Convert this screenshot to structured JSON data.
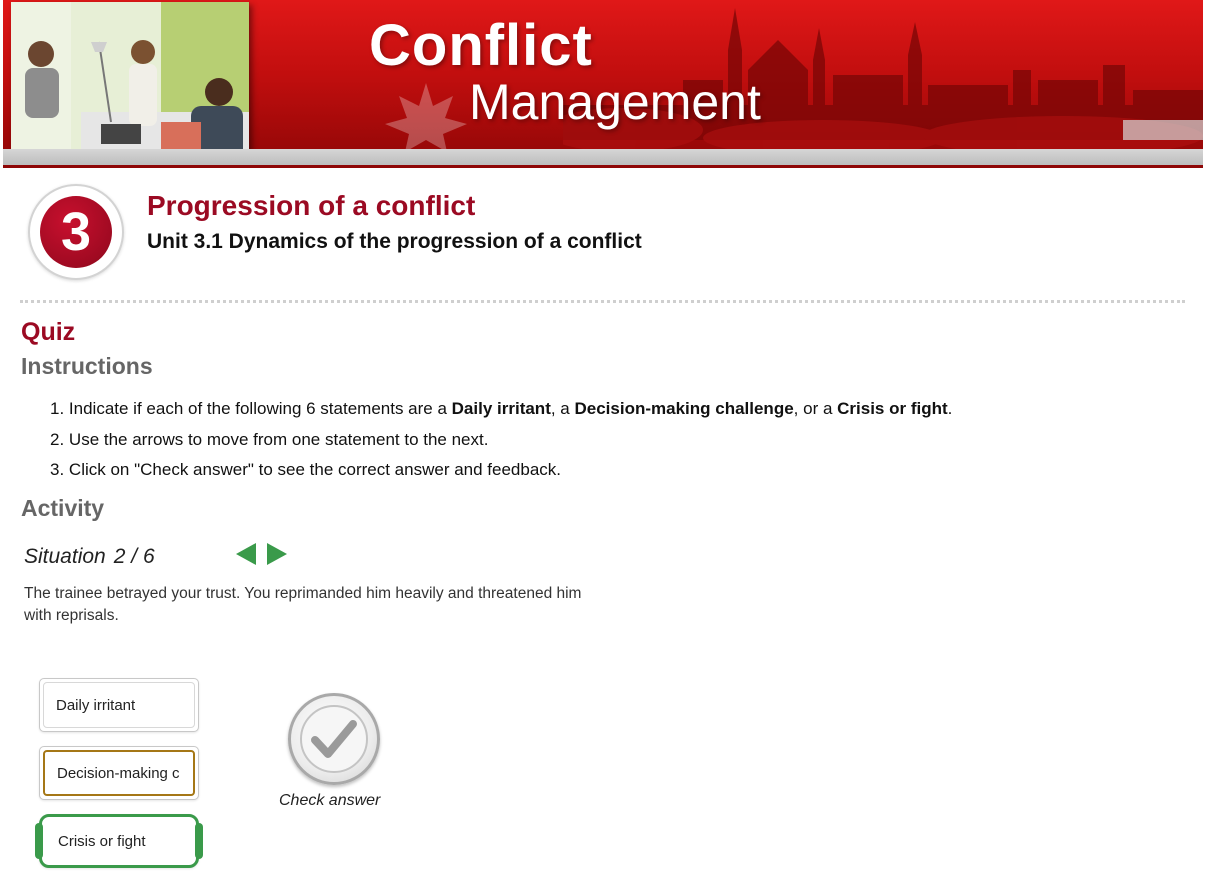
{
  "banner": {
    "title": "Conflict",
    "subtitle": "Management"
  },
  "module": {
    "number": "3",
    "title": "Progression of a conflict",
    "unit_title": "Unit 3.1 Dynamics of the progression of a conflict"
  },
  "quiz": {
    "heading": "Quiz",
    "instructions_heading": "Instructions",
    "instructions": [
      {
        "number": "1.",
        "parts": [
          {
            "text": "Indicate if each of the following 6 statements are a ",
            "bold": false
          },
          {
            "text": "Daily irritant",
            "bold": true
          },
          {
            "text": ", a ",
            "bold": false
          },
          {
            "text": "Decision-making challenge",
            "bold": true
          },
          {
            "text": ", or a ",
            "bold": false
          },
          {
            "text": "Crisis or fight",
            "bold": true
          },
          {
            "text": ".",
            "bold": false
          }
        ]
      },
      {
        "number": "2.",
        "parts": [
          {
            "text": "Use the arrows to move from one statement to the next.",
            "bold": false
          }
        ]
      },
      {
        "number": "3.",
        "parts": [
          {
            "text": "Click on \"Check answer\" to see the correct answer and feedback.",
            "bold": false
          }
        ]
      }
    ],
    "activity_heading": "Activity",
    "situation": {
      "label": "Situation",
      "current": "2",
      "separator": "/",
      "total": "6",
      "statement": "The trainee betrayed your trust. You reprimanded him heavily and threatened him with reprisals."
    },
    "choices": [
      {
        "label": "Daily irritant",
        "state": "default"
      },
      {
        "label": "Decision-making c",
        "state": "selected-brown"
      },
      {
        "label": "Crisis or fight",
        "state": "selected-green"
      }
    ],
    "check_answer_label": "Check answer",
    "colors": {
      "accent_red": "#9b0a23",
      "heading_grey": "#666666",
      "nav_green": "#3a9a4a",
      "choice_brown": "#a57716"
    }
  }
}
